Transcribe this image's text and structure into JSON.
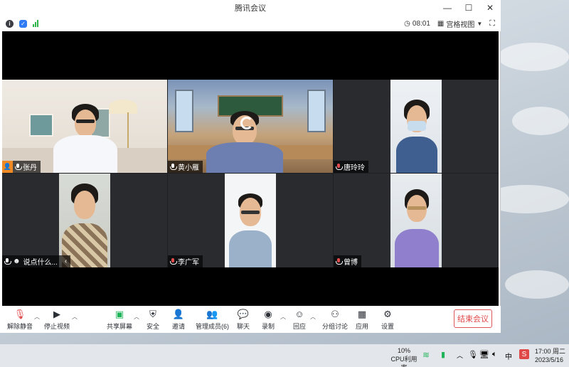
{
  "window": {
    "title": "腾讯会议",
    "controls": [
      "—",
      "☐",
      "✕"
    ]
  },
  "infobar": {
    "timer": "08:01",
    "view_mode": "宫格视图"
  },
  "participants": [
    {
      "name": "张丹",
      "muted": false,
      "host": true,
      "active": false
    },
    {
      "name": "黄小雁",
      "muted": false,
      "host": false,
      "active": true
    },
    {
      "name": "唐玲玲",
      "muted": true,
      "host": false,
      "active": false
    },
    {
      "name": "说点什么...",
      "muted": false,
      "host": false,
      "active": false
    },
    {
      "name": "李广军",
      "muted": true,
      "host": false,
      "active": false
    },
    {
      "name": "曾博",
      "muted": true,
      "host": false,
      "active": false
    }
  ],
  "toolbar": {
    "unmute": "解除静音",
    "stop_video": "停止视频",
    "share_screen": "共享屏幕",
    "security": "安全",
    "invite": "邀请",
    "manage_members": "管理成员(6)",
    "chat": "聊天",
    "record": "录制",
    "reaction": "回应",
    "breakout": "分组讨论",
    "apps": "应用",
    "settings": "设置",
    "end_meeting": "结束会议"
  },
  "taskbar": {
    "cpu_percent": "10%",
    "cpu_label": "CPU利用率",
    "ime": "中",
    "time": "17:00 周二",
    "date": "2023/5/16"
  },
  "colors": {
    "accent_green": "#1fb35a",
    "end_red": "#e04848",
    "host_orange": "#f08a24"
  }
}
